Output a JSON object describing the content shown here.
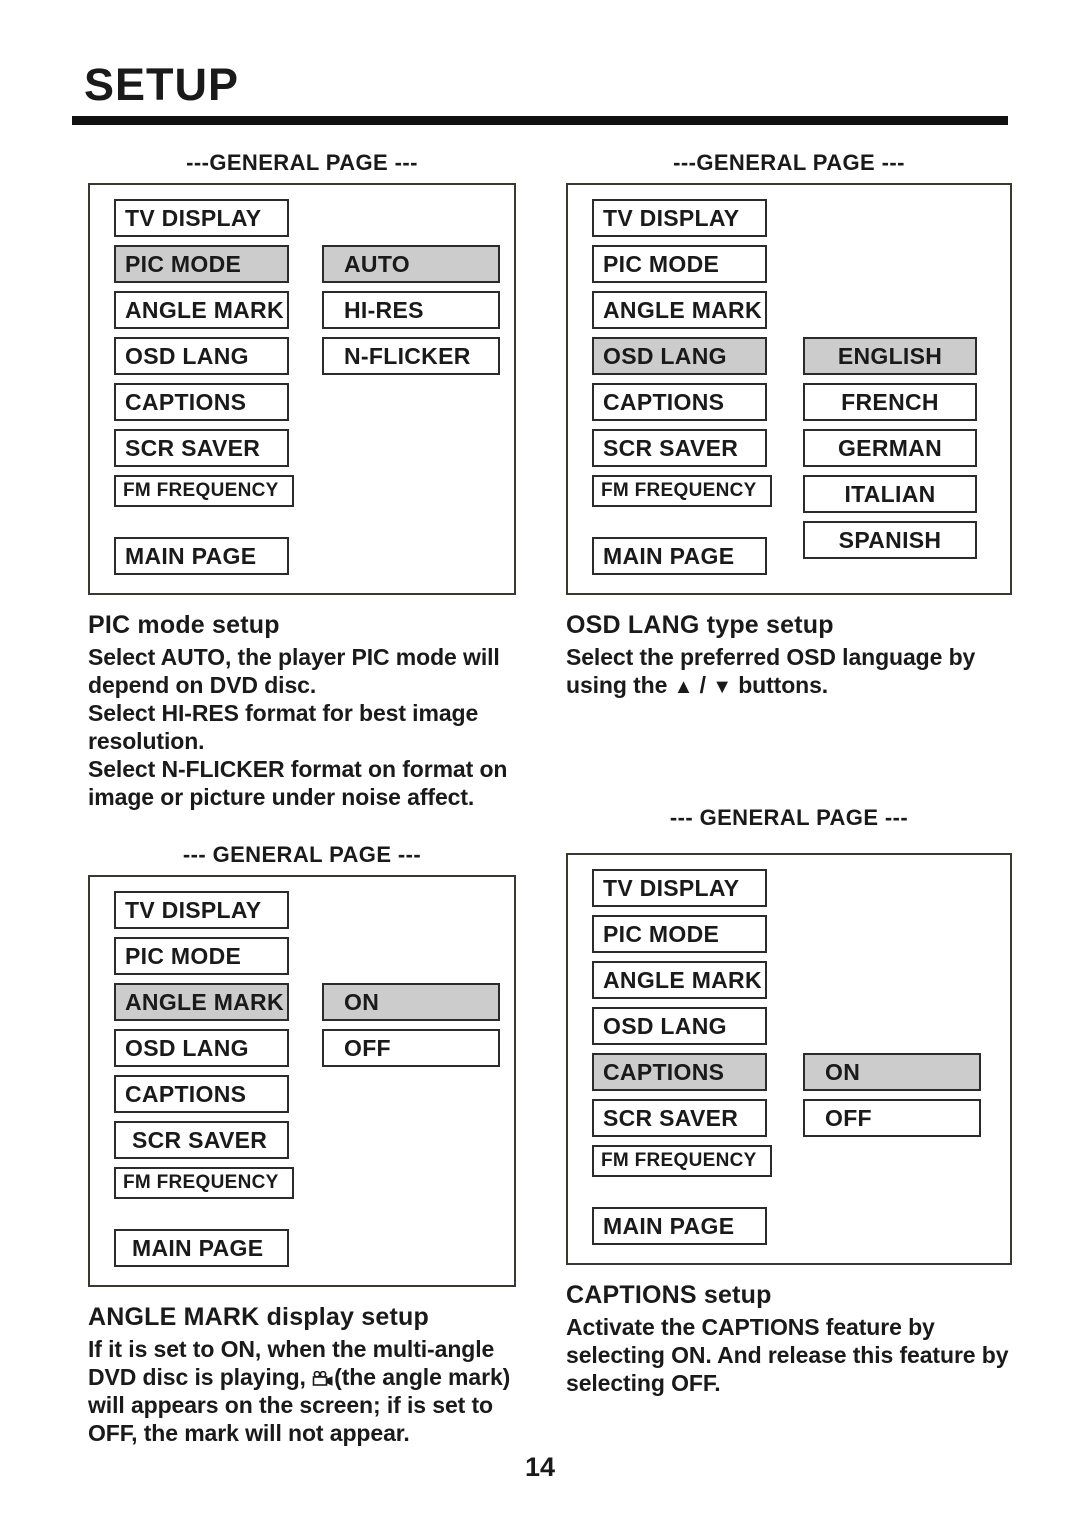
{
  "header": {
    "title": "SETUP"
  },
  "page_number": "14",
  "screens": {
    "pic_mode": {
      "caption": "---GENERAL PAGE ---",
      "menu_items": [
        {
          "label": "TV DISPLAY",
          "selected": false
        },
        {
          "label": "PIC MODE",
          "selected": true
        },
        {
          "label": "ANGLE MARK",
          "selected": false
        },
        {
          "label": "OSD LANG",
          "selected": false
        },
        {
          "label": "CAPTIONS",
          "selected": false
        },
        {
          "label": "SCR SAVER",
          "selected": false
        },
        {
          "label": "FM FREQUENCY",
          "selected": false
        },
        {
          "label": "MAIN PAGE",
          "selected": false
        }
      ],
      "options": [
        {
          "label": "AUTO",
          "selected": true
        },
        {
          "label": "HI-RES",
          "selected": false
        },
        {
          "label": "N-FLICKER",
          "selected": false
        }
      ]
    },
    "osd_lang": {
      "caption": "---GENERAL PAGE ---",
      "menu_items": [
        {
          "label": "TV DISPLAY",
          "selected": false
        },
        {
          "label": "PIC MODE",
          "selected": false
        },
        {
          "label": "ANGLE MARK",
          "selected": false
        },
        {
          "label": "OSD LANG",
          "selected": true
        },
        {
          "label": "CAPTIONS",
          "selected": false
        },
        {
          "label": "SCR SAVER",
          "selected": false
        },
        {
          "label": "FM FREQUENCY",
          "selected": false
        },
        {
          "label": "MAIN PAGE",
          "selected": false
        }
      ],
      "options": [
        {
          "label": "ENGLISH",
          "selected": true
        },
        {
          "label": "FRENCH",
          "selected": false
        },
        {
          "label": "GERMAN",
          "selected": false
        },
        {
          "label": "ITALIAN",
          "selected": false
        },
        {
          "label": "SPANISH",
          "selected": false
        }
      ]
    },
    "angle_mark": {
      "caption": "--- GENERAL PAGE ---",
      "menu_items": [
        {
          "label": "TV DISPLAY",
          "selected": false
        },
        {
          "label": "PIC MODE",
          "selected": false
        },
        {
          "label": "ANGLE MARK",
          "selected": true
        },
        {
          "label": "OSD LANG",
          "selected": false
        },
        {
          "label": "CAPTIONS",
          "selected": false
        },
        {
          "label": "SCR SAVER",
          "selected": false
        },
        {
          "label": "FM FREQUENCY",
          "selected": false
        },
        {
          "label": "MAIN PAGE",
          "selected": false
        }
      ],
      "options": [
        {
          "label": "ON",
          "selected": true
        },
        {
          "label": "OFF",
          "selected": false
        }
      ]
    },
    "captions": {
      "caption": "--- GENERAL PAGE ---",
      "menu_items": [
        {
          "label": "TV DISPLAY",
          "selected": false
        },
        {
          "label": "PIC MODE",
          "selected": false
        },
        {
          "label": "ANGLE MARK",
          "selected": false
        },
        {
          "label": "OSD LANG",
          "selected": false
        },
        {
          "label": "CAPTIONS",
          "selected": true
        },
        {
          "label": "SCR SAVER",
          "selected": false
        },
        {
          "label": "FM FREQUENCY",
          "selected": false
        },
        {
          "label": "MAIN PAGE",
          "selected": false
        }
      ],
      "options": [
        {
          "label": "ON",
          "selected": true
        },
        {
          "label": "OFF",
          "selected": false
        }
      ]
    }
  },
  "sections": {
    "pic_mode": {
      "heading": "PIC mode setup",
      "lines": [
        "Select AUTO, the player PIC mode will depend on DVD disc.",
        "Select HI-RES format for best image resolution.",
        "Select N-FLICKER format on format on image or picture under noise affect."
      ]
    },
    "osd_lang": {
      "heading": "OSD LANG type setup",
      "text_before_arrows": "Select the preferred OSD language by using the ",
      "arrow_up": "▲",
      "arrow_separator": " / ",
      "arrow_down": "▼",
      "text_after_arrows": " buttons."
    },
    "angle_mark": {
      "heading": "ANGLE MARK display setup",
      "text_before_icon": "If it is set to ON, when the multi-angle DVD disc is playing, ",
      "icon_name": "movie-camera-icon",
      "text_after_icon": "(the angle mark) will appears on the screen; if is set to OFF, the mark will not appear."
    },
    "captions": {
      "heading": "CAPTIONS setup",
      "lines": [
        "Activate the CAPTIONS feature by selecting ON. And release this feature by selecting OFF."
      ]
    }
  }
}
